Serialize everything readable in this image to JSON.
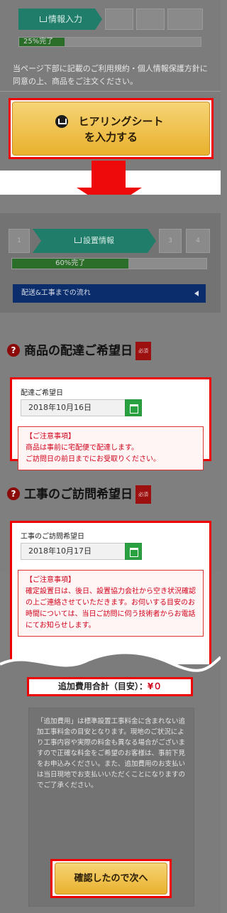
{
  "section1": {
    "step_label": "情報入力",
    "progress_label": "25%完了",
    "progress_value": 0.25,
    "intro_text": "当ページ下部に記載のご利用規約・個人情報保護方針に同意の上、商品をご注文ください。",
    "hearing_button_line1": "ヒアリングシート",
    "hearing_button_line2": "を入力する"
  },
  "section2": {
    "steps": [
      "1",
      "設置情報",
      "3",
      "4"
    ],
    "progress_label": "60%完了",
    "progress_value": 0.6,
    "flow_label": "配送&工事までの流れ",
    "delivery": {
      "heading": "商品の配達ご希望日",
      "required_badge": "必須",
      "field_label": "配達ご希望日",
      "date_value": "2018年10月16日",
      "notice_title": "【ご注意事項】",
      "notice_lines": [
        "商品は事前に宅配便で配達します。",
        "ご訪問日の前日までにお受取りください。"
      ]
    },
    "visit": {
      "heading": "工事のご訪問希望日",
      "required_badge": "必須",
      "field_label": "工事のご訪問希望日",
      "date_value": "2018年10月17日",
      "notice_title": "【ご注意事項】",
      "notice_body": "確定設置日は、後日、設置協力会社から空き状況確認の上ご連絡させていただきます。お伺いする目安のお時間については、当日ご訪問に伺う技術者からお電話にてお知らせします。"
    }
  },
  "section3": {
    "total_label": "追加費用合計（目安）：",
    "total_value": "¥０",
    "note_text": "「追加費用」は標準設置工事料金に含まれない追加工事料金の目安となります。現地のご状況により工事内容や実際の料金も異なる場合がございますので正確な料金をご希望のお客様は、事前下見をお申込みください。また、追加費用のお支払いは当日現地でお支払いいただくことになりますのでご了承ください。",
    "confirm_button": "確認したので次へ"
  },
  "colors": {
    "highlight_red": "#ee0a0a",
    "step_green": "#1f7d6a",
    "navy": "#0b2d6b",
    "button_gold": "#e9b12d"
  }
}
